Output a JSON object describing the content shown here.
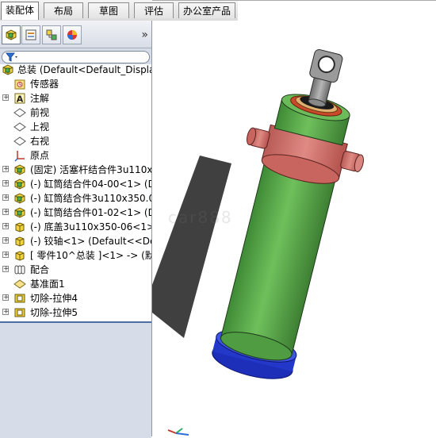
{
  "tabs": [
    {
      "label": "装配体",
      "active": true
    },
    {
      "label": "布局",
      "active": false
    },
    {
      "label": "草图",
      "active": false
    },
    {
      "label": "评估",
      "active": false
    },
    {
      "label": "办公室产品",
      "active": false
    }
  ],
  "pane": {
    "expand_glyph": "»",
    "filter_icon": "funnel-icon"
  },
  "tree": {
    "root_label": "总装  (Default<Default_Display",
    "items": [
      {
        "label": "传感器",
        "icon": "sensor-icon",
        "expandable": false
      },
      {
        "label": "注解",
        "icon": "annotation-icon",
        "expandable": true
      },
      {
        "label": "前视",
        "icon": "plane-icon",
        "expandable": false
      },
      {
        "label": "上视",
        "icon": "plane-icon",
        "expandable": false
      },
      {
        "label": "右视",
        "icon": "plane-icon",
        "expandable": false
      },
      {
        "label": "原点",
        "icon": "origin-icon",
        "expandable": false
      },
      {
        "label": "(固定) 活塞杆结合件3u110x3",
        "icon": "subassembly-icon",
        "expandable": true
      },
      {
        "label": "(-) 缸筒结合件04-00<1> (D",
        "icon": "subassembly-icon",
        "expandable": true
      },
      {
        "label": "(-) 缸筒结合件3u110x350.0",
        "icon": "subassembly-icon",
        "expandable": true
      },
      {
        "label": "(-) 缸筒结合件01-02<1> (D",
        "icon": "subassembly-icon",
        "expandable": true
      },
      {
        "label": "(-) 底盖3u110x350-06<1>",
        "icon": "part-icon",
        "expandable": true
      },
      {
        "label": "(-) 铰轴<1> (Default<<Def",
        "icon": "part-icon",
        "expandable": true
      },
      {
        "label": "[ 零件10^总装 ]<1> -> (默",
        "icon": "virtual-part-icon",
        "expandable": true
      },
      {
        "label": "配合",
        "icon": "mates-icon",
        "expandable": true
      },
      {
        "label": "基准面1",
        "icon": "plane-icon",
        "expandable": false
      },
      {
        "label": "切除-拉伸4",
        "icon": "cut-extrude-icon",
        "expandable": true
      },
      {
        "label": "切除-拉伸5",
        "icon": "cut-extrude-icon",
        "expandable": true
      }
    ]
  },
  "viewport": {
    "watermark": "car888"
  },
  "colors": {
    "cylinder_green": "#5fae4f",
    "collar_red": "#d9736e",
    "base_blue": "#1d2fb8",
    "rod_gray": "#8e8e8e",
    "tree_selection_blue": "#4a6fa8"
  }
}
